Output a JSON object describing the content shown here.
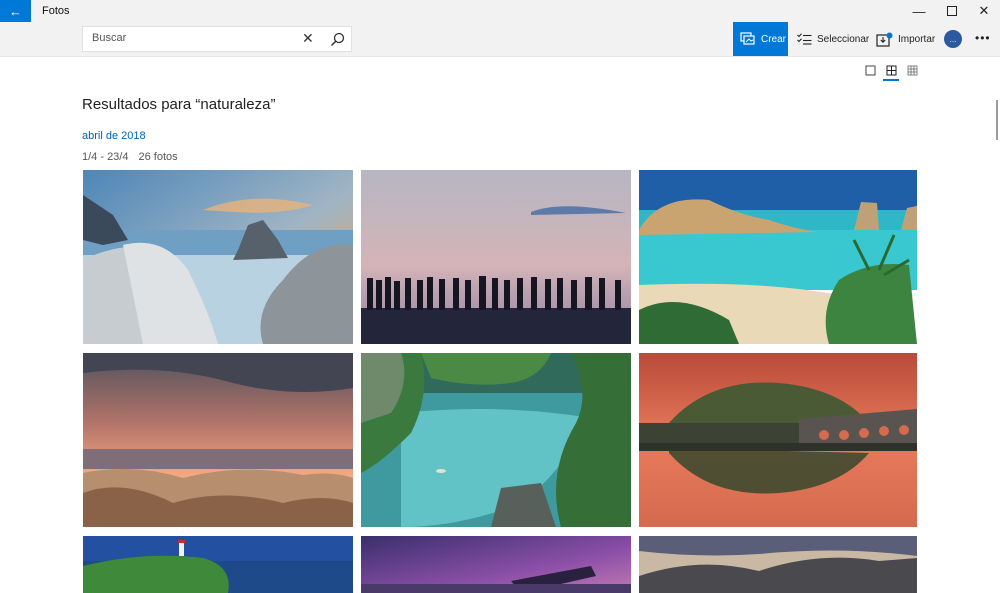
{
  "window": {
    "title": "Fotos"
  },
  "toolbar": {
    "search_placeholder": "Buscar",
    "crear_label": "Crear",
    "seleccionar_label": "Seleccionar",
    "importar_label": "Importar",
    "avatar_initial": "..."
  },
  "view_modes": [
    "single",
    "grid-medium",
    "grid-small"
  ],
  "active_view_mode": "grid-medium",
  "results": {
    "title": "Resultados para “naturaleza”",
    "group_label": "abril de 2018",
    "date_range": "1/4 - 23/4",
    "count": "26 fotos"
  },
  "photos": [
    {
      "scene": "rocky-coast-long-exposure"
    },
    {
      "scene": "people-silhouettes-at-dusk"
    },
    {
      "scene": "turquoise-bay-with-palms"
    },
    {
      "scene": "desert-cliffs-sunset"
    },
    {
      "scene": "lagoon-between-karst-cliffs"
    },
    {
      "scene": "lake-reflection-with-bridge"
    },
    {
      "scene": "lighthouse-on-green-cape"
    },
    {
      "scene": "purple-sky-shipwreck"
    },
    {
      "scene": "mountain-ridge-dusk"
    }
  ]
}
